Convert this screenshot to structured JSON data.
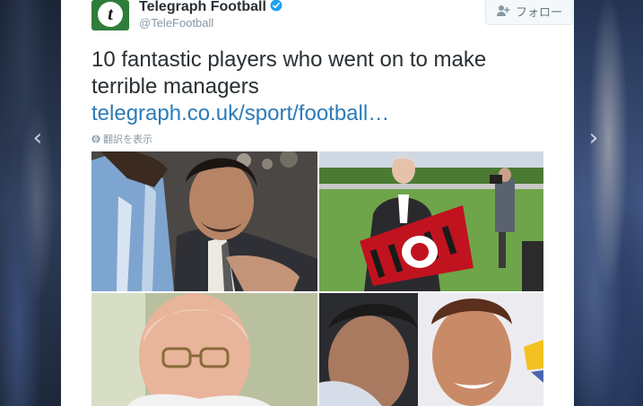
{
  "account": {
    "display_name": "Telegraph Football",
    "handle": "@TeleFootball",
    "avatar_letter": "t",
    "verified": true
  },
  "follow_button": {
    "label": "フォロー"
  },
  "tweet": {
    "text": "10 fantastic players who went on to make terrible managers",
    "link": "telegraph.co.uk/sport/football…",
    "translate_label": "翻訳を表示"
  },
  "navigation": {
    "prev_icon": "chevron-left-icon",
    "next_icon": "chevron-right-icon"
  },
  "media": {
    "photos": [
      "photo-maradona",
      "photo-manager-with-flag",
      "photo-older-man-glasses",
      "photo-two-men-close-up"
    ]
  },
  "colors": {
    "link": "#2b7bb9",
    "text": "#292f33",
    "muted": "#8899a6",
    "verified": "#1da1f2",
    "avatar_bg": "#2f7d3a"
  }
}
